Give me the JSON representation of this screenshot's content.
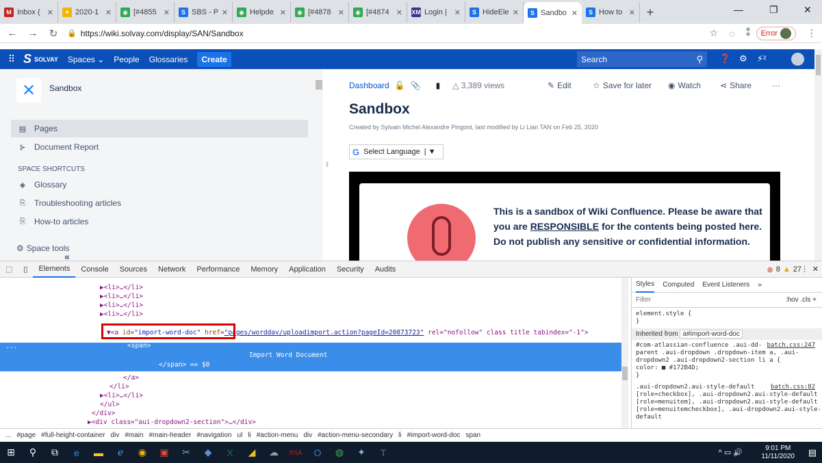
{
  "browser": {
    "tabs": [
      {
        "label": "Inbox (",
        "fav": "M",
        "color": "#c5221f"
      },
      {
        "label": "2020-1",
        "fav": "✦",
        "color": "#f4b400"
      },
      {
        "label": "[#4855",
        "fav": "◉",
        "color": "#2eaa52"
      },
      {
        "label": "SBS - P",
        "fav": "S",
        "color": "#1a73e8"
      },
      {
        "label": "Helpde",
        "fav": "◉",
        "color": "#2eaa52"
      },
      {
        "label": "[#4878",
        "fav": "◉",
        "color": "#2eaa52"
      },
      {
        "label": "[#4874",
        "fav": "◉",
        "color": "#2eaa52"
      },
      {
        "label": "Login |",
        "fav": "XM",
        "color": "#3b2f8f"
      },
      {
        "label": "HideEle",
        "fav": "S",
        "color": "#1a73e8"
      },
      {
        "label": "Sandbo",
        "fav": "S",
        "color": "#1a73e8"
      },
      {
        "label": "How to",
        "fav": "S",
        "color": "#1a73e8"
      }
    ],
    "url": "https://wiki.solvay.com/display/SAN/Sandbox",
    "error_label": "Error"
  },
  "confluence": {
    "brand": "SOLVAY",
    "nav": [
      "Spaces ⌄",
      "People",
      "Glossaries"
    ],
    "create_label": "Create",
    "search_placeholder": "Search",
    "space_name": "Sandbox",
    "sidebar_items": [
      "Pages",
      "Document Report"
    ],
    "shortcuts_heading": "SPACE SHORTCUTS",
    "shortcuts": [
      "Glossary",
      "Troubleshooting articles",
      "How-to articles"
    ],
    "space_tools": "Space tools",
    "breadcrumb": "Dashboard",
    "views": "3,389 views",
    "actions": {
      "edit": "Edit",
      "save": "Save for later",
      "watch": "Watch",
      "share": "Share"
    },
    "page_title": "Sandbox",
    "byline": "Created by Sylvain Michel Alexandre Pingont, last modified by Li Lian TAN on Feb 25, 2020",
    "language_label": "Select Language",
    "notice_1": "This is a sandbox of Wiki Confluence. Please be aware that you are ",
    "notice_u": "RESPONSIBLE",
    "notice_2": " for the contents being posted here. Do not publish any sensitive or confidential information."
  },
  "devtools": {
    "tabs": [
      "Elements",
      "Console",
      "Sources",
      "Network",
      "Performance",
      "Memory",
      "Application",
      "Security",
      "Audits"
    ],
    "errors": "8",
    "warnings": "27",
    "dom": {
      "li": "▶<li>…</li>",
      "li_close": "</li>",
      "a_open": "▼<a ",
      "a_id_attr": "id",
      "a_id_val": "\"import-word-doc\"",
      "a_href_attr": "href",
      "a_href_val": "\"pages/worddav/uploadimport.action?pageId=20873723\"",
      "a_rest": " rel=\"nofollow\" class title tabindex=\"-1\">",
      "span_open": "<span>",
      "span_text": "Import Word Document",
      "span_close": "</span> == $0",
      "a_close": "</a>",
      "ul_close": "</ul>",
      "div_close": "</div>",
      "div_section": "▶<div class=\"aui-dropdown2-section\">…</div>",
      "dots": "..."
    },
    "styles_tabs": [
      "Styles",
      "Computed",
      "Event Listeners",
      "»"
    ],
    "filter_placeholder": "Filter",
    "filter_tools": ":hov  .cls  +",
    "element_style": "element.style {",
    "close_brace": "}",
    "inherited_label": "Inherited from",
    "inherited_target": "a#import-word-doc",
    "rule1_link": "batch.css:247",
    "rule1_sel": "#com-atlassian-confluence .aui-dd-parent .aui-dropdown .dropdown-item a, .aui-dropdown2 .aui-dropdown2-section li a {",
    "rule1_prop": "  color: ■ #172B4D;",
    "rule2_link": "batch.css:82",
    "rule2_sel": ".aui-dropdown2.aui-style-default [role=checkbox], .aui-dropdown2.aui-style-default [role=menuitem], .aui-dropdown2.aui-style-default [role=menuitemcheckbox], .aui-dropdown2.aui-style-default",
    "breadcrumbs": [
      "...",
      "#page",
      "#full-height-container",
      "div",
      "#main",
      "#main-header",
      "#navigation",
      "ul",
      "li",
      "#action-menu",
      "div",
      "#action-menu-secondary",
      "li",
      "#import-word-doc",
      "span"
    ]
  },
  "taskbar": {
    "time": "9:01 PM",
    "date": "11/11/2020"
  }
}
